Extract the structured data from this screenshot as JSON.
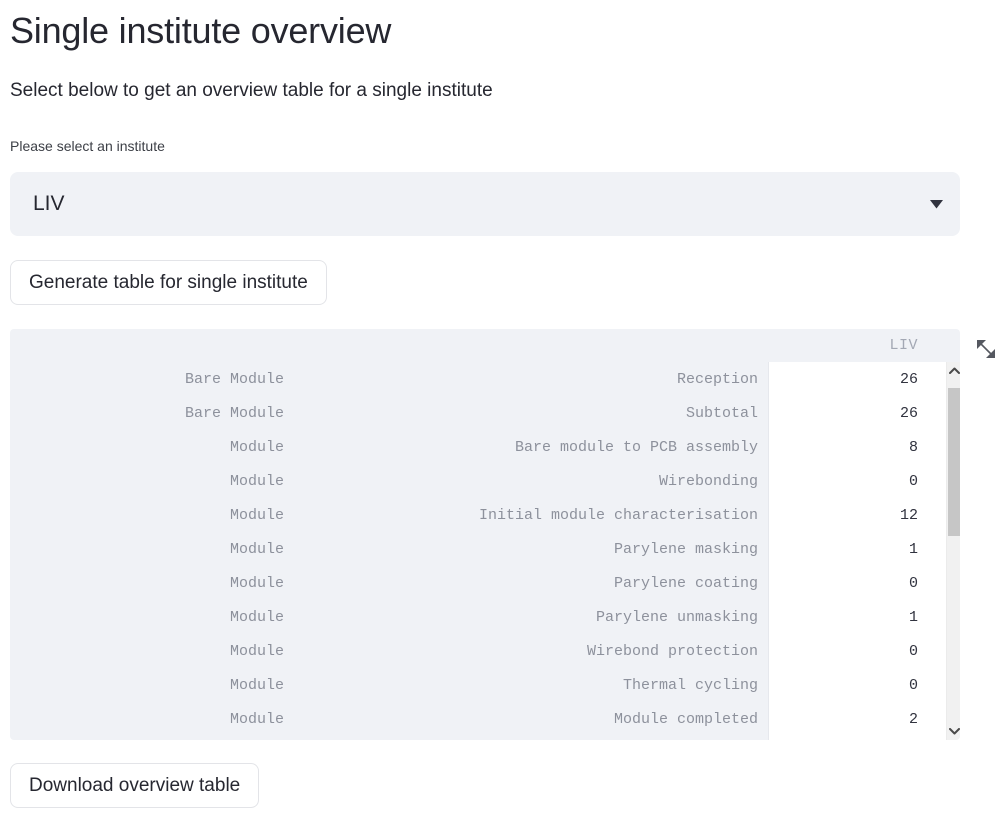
{
  "header": {
    "title": "Single institute overview",
    "subtitle": "Select below to get an overview table for a single institute"
  },
  "select": {
    "label": "Please select an institute",
    "value": "LIV",
    "caret_icon": "chevron-down-icon"
  },
  "buttons": {
    "generate": "Generate table for single institute",
    "download": "Download overview table"
  },
  "table": {
    "column_header": "LIV",
    "expand_icon": "expand-diagonal-icon",
    "columns": [
      "group",
      "step",
      "LIV"
    ],
    "rows": [
      {
        "group": "Bare Module",
        "step": "Reception",
        "value": "26"
      },
      {
        "group": "Bare Module",
        "step": "Subtotal",
        "value": "26"
      },
      {
        "group": "Module",
        "step": "Bare module to PCB assembly",
        "value": "8"
      },
      {
        "group": "Module",
        "step": "Wirebonding",
        "value": "0"
      },
      {
        "group": "Module",
        "step": "Initial module characterisation",
        "value": "12"
      },
      {
        "group": "Module",
        "step": "Parylene masking",
        "value": "1"
      },
      {
        "group": "Module",
        "step": "Parylene coating",
        "value": "0"
      },
      {
        "group": "Module",
        "step": "Parylene unmasking",
        "value": "1"
      },
      {
        "group": "Module",
        "step": "Wirebond protection",
        "value": "0"
      },
      {
        "group": "Module",
        "step": "Thermal cycling",
        "value": "0"
      },
      {
        "group": "Module",
        "step": "Module completed",
        "value": "2"
      }
    ],
    "scrollbar": {
      "up_icon": "chevron-up-icon",
      "down_icon": "chevron-down-icon"
    }
  },
  "colors": {
    "widget_background": "#f0f2f6",
    "text_primary": "#262730",
    "text_muted": "#8d919c",
    "panel_white": "#ffffff",
    "scrollbar_thumb": "#c6c6c6"
  }
}
